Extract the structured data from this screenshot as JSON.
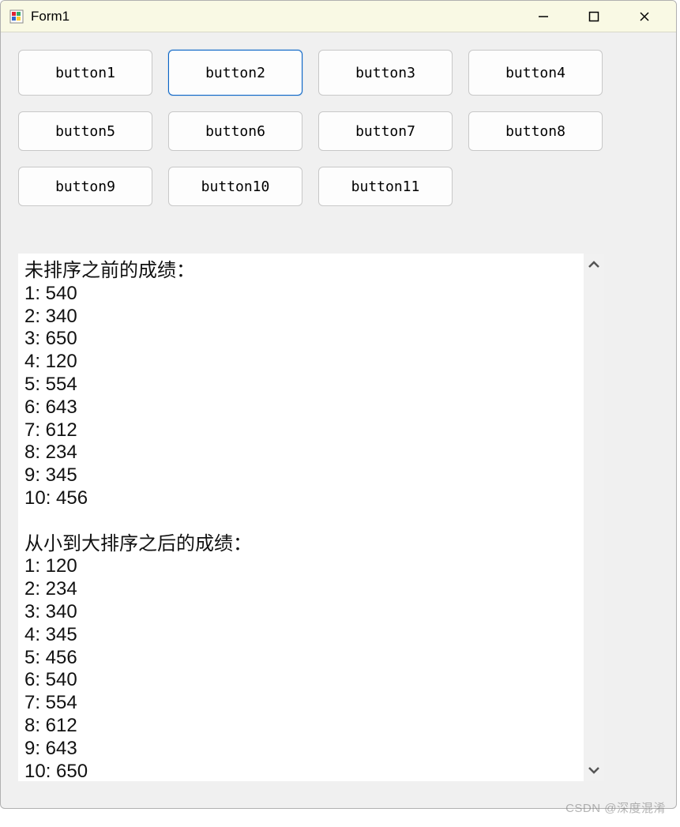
{
  "window": {
    "title": "Form1"
  },
  "buttons": {
    "row1": [
      "button1",
      "button2",
      "button3",
      "button4"
    ],
    "row2": [
      "button5",
      "button6",
      "button7",
      "button8"
    ],
    "row3": [
      "button9",
      "button10",
      "button11"
    ]
  },
  "output": {
    "header_unsorted": "未排序之前的成绩：",
    "unsorted": [
      "1: 540",
      "2: 340",
      "3: 650",
      "4: 120",
      "5: 554",
      "6: 643",
      "7: 612",
      "8: 234",
      "9: 345",
      "10: 456"
    ],
    "header_sorted": "从小到大排序之后的成绩：",
    "sorted": [
      "1: 120",
      "2: 234",
      "3: 340",
      "4: 345",
      "5: 456",
      "6: 540",
      "7: 554",
      "8: 612",
      "9: 643",
      "10: 650"
    ]
  },
  "watermark": "CSDN @深度混淆"
}
